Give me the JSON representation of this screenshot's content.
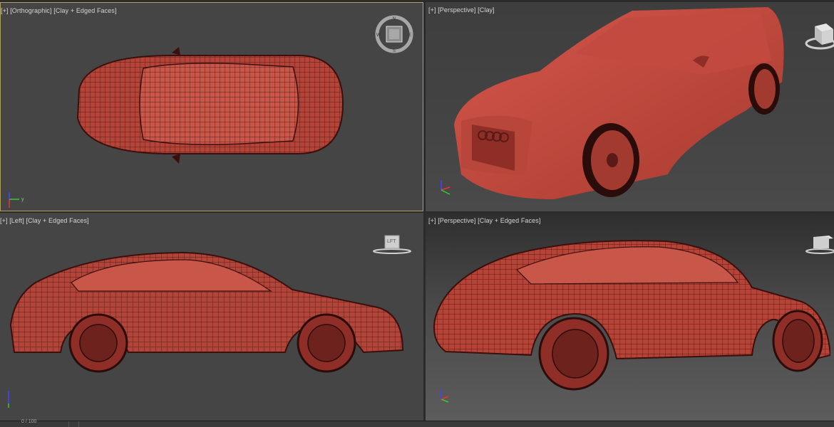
{
  "viewports": {
    "top_left": {
      "bracket": "+",
      "view": "Orthographic",
      "mode": "Clay + Edged Faces"
    },
    "top_right": {
      "bracket": "+",
      "view": "Perspective",
      "mode": "Clay"
    },
    "bottom_left": {
      "bracket": "+",
      "view": "Left",
      "mode": "Clay + Edged Faces"
    },
    "bottom_right": {
      "bracket": "+",
      "view": "Perspective",
      "mode": "Clay + Edged Faces"
    }
  },
  "view_cube": {
    "left_face": "LFT"
  },
  "timeline": {
    "counter": "0 / 100"
  },
  "colors": {
    "clay": "#c44a3e",
    "clay_dark": "#7a2a24",
    "wire": "#4a1512",
    "active_border": "#b3a05a",
    "viewport_bg": "#454545"
  },
  "icons": [
    "view-cube-icon",
    "axis-tripod-icon",
    "compass-ring-icon"
  ]
}
